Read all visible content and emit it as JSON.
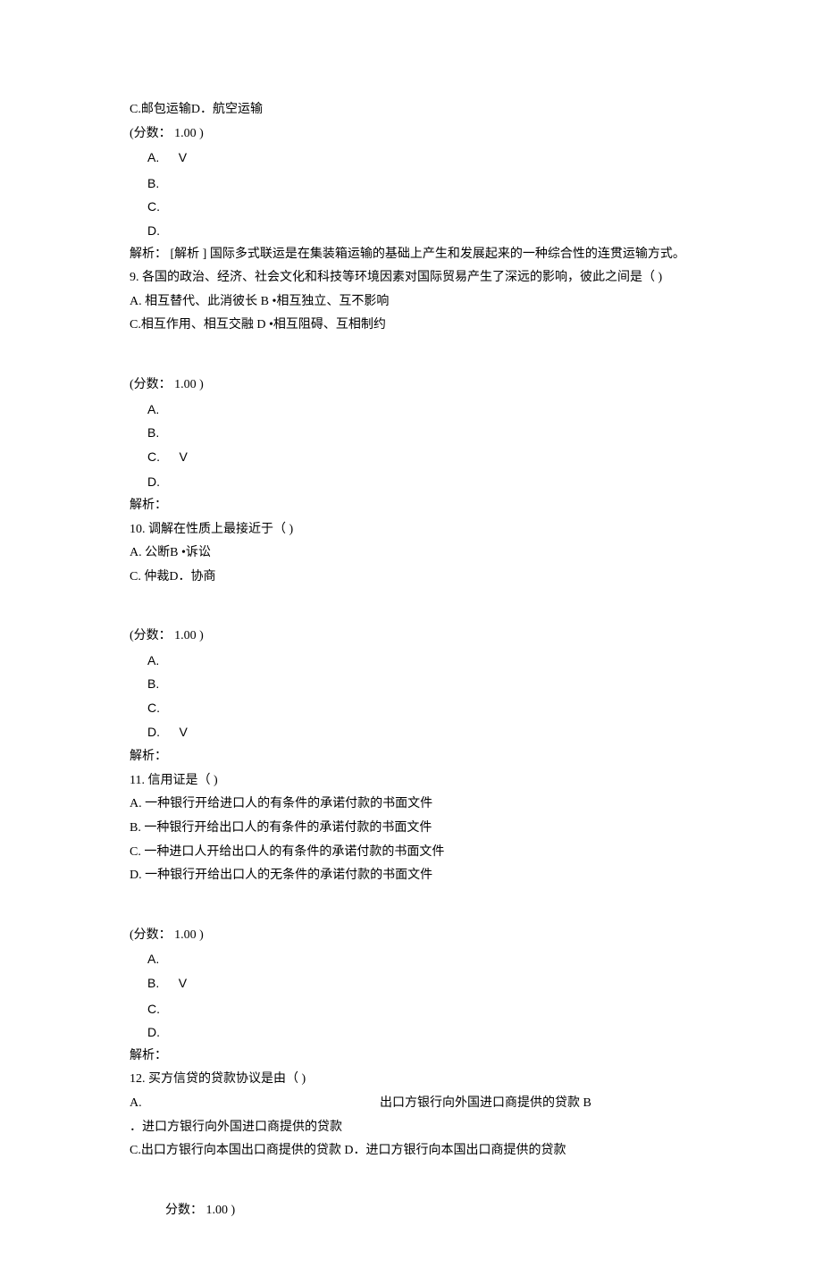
{
  "q8": {
    "optCD": "C.邮包运输D．航空运输",
    "score": "(分数： 1.00 )",
    "A": "A.",
    "Acheck": "V",
    "B": "B.",
    "C": "C.",
    "D": "D.",
    "analysis": "解析：  [解析 ] 国际多式联运是在集装箱运输的基础上产生和发展起来的一种综合性的连贯运输方式。"
  },
  "q9": {
    "stem": "9.  各国的政治、经济、社会文化和科技等环境因素对国际贸易产生了深远的影响，彼此之间是（ )",
    "lineAB": "A.                                             相互替代、此消彼长     B •相互独立、互不影响",
    "lineCD": "C.相互作用、相互交融     D •相互阻碍、互相制约",
    "score": "(分数： 1.00 )",
    "A": "A.",
    "B": "B.",
    "C": "C.",
    "Ccheck": "V",
    "D": "D.",
    "analysis": "解析："
  },
  "q10": {
    "stem": "10.  调解在性质上最接近于（ )",
    "lineAB": "A.      公断B •诉讼",
    "lineCD": "C.      仲裁D．协商",
    "score": "(分数： 1.00 )",
    "A": "A.",
    "B": "B.",
    "C": "C.",
    "D": "D.",
    "Dcheck": "V",
    "analysis": "解析："
  },
  "q11": {
    "stem": "11.  信用证是（ )",
    "optA": "A.  一种银行开给进口人的有条件的承诺付款的书面文件",
    "optB": "B.  一种银行开给出口人的有条件的承诺付款的书面文件",
    "optC": "C.  一种进口人开给出口人的有条件的承诺付款的书面文件",
    "optD": "D.  一种银行开给出口人的无条件的承诺付款的书面文件",
    "score": "(分数： 1.00 )",
    "A": "A.",
    "B": "B.",
    "Bcheck": "V",
    "C": "C.",
    "D": "D.",
    "analysis": "解析："
  },
  "q12": {
    "stem": "12.  买方信贷的贷款协议是由（ )",
    "lineA_left": "A.",
    "lineA_right": "出口方银行向外国进口商提供的贷款 B",
    "lineB": "．进口方银行向外国进口商提供的贷款",
    "lineCD": "C.出口方银行向本国出口商提供的贷款        D．进口方银行向本国出口商提供的贷款",
    "score": "分数： 1.00 )"
  }
}
